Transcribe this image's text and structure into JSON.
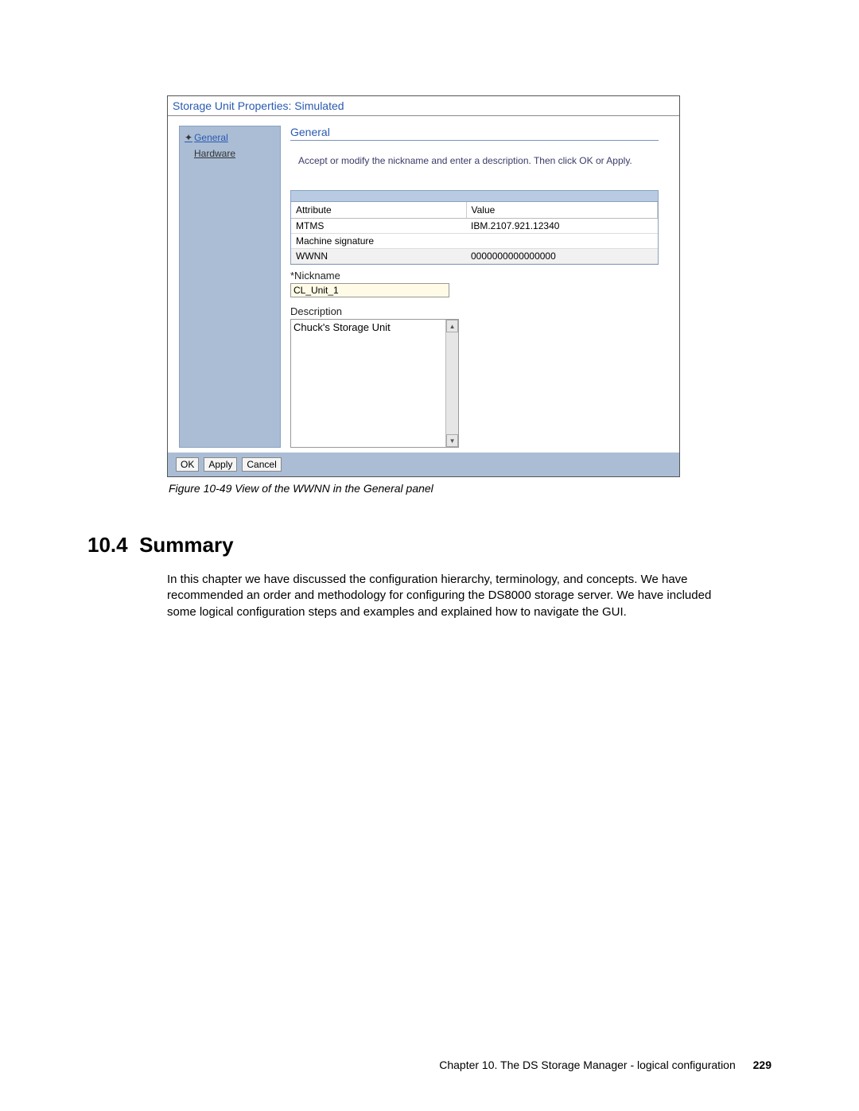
{
  "screenshot": {
    "window_title": "Storage Unit Properties: Simulated",
    "sidebar": {
      "items": [
        {
          "label": "General",
          "selected": true,
          "bullet": "✦"
        },
        {
          "label": "Hardware",
          "selected": false,
          "bullet": ""
        }
      ]
    },
    "panel_title": "General",
    "instruction": "Accept or modify the nickname and enter a description. Then click OK or Apply.",
    "table": {
      "headers": [
        "Attribute",
        "Value"
      ],
      "rows": [
        {
          "attr": "MTMS",
          "val": "IBM.2107.921.12340"
        },
        {
          "attr": "Machine signature",
          "val": ""
        },
        {
          "attr": "WWNN",
          "val": "0000000000000000"
        }
      ]
    },
    "nickname_label": "*Nickname",
    "nickname_value": "CL_Unit_1",
    "description_label": "Description",
    "description_value": "Chuck's Storage Unit",
    "buttons": {
      "ok": "OK",
      "apply": "Apply",
      "cancel": "Cancel"
    }
  },
  "caption": "Figure 10-49   View of the WWNN in the General panel",
  "section": {
    "number": "10.4",
    "title": "Summary",
    "body": "In this chapter we have discussed the configuration hierarchy, terminology, and concepts. We have recommended an order and methodology for configuring the DS8000 storage server. We have included some logical configuration steps and examples and explained how to navigate the GUI."
  },
  "footer": {
    "chapter": "Chapter 10. The DS Storage Manager - logical configuration",
    "page": "229"
  }
}
